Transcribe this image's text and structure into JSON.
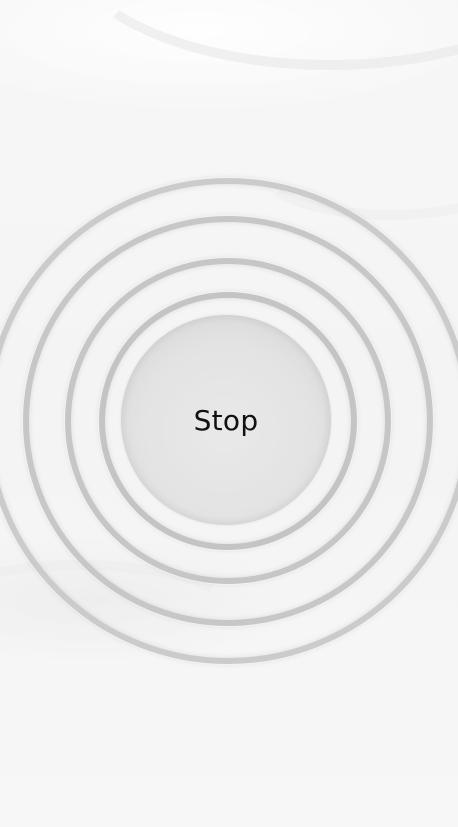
{
  "button": {
    "label": "Stop"
  },
  "colors": {
    "background": "#f6f6f6",
    "ring": "#c8c8c8",
    "button_fill": "#e3e3e3",
    "label_text": "#111111"
  }
}
